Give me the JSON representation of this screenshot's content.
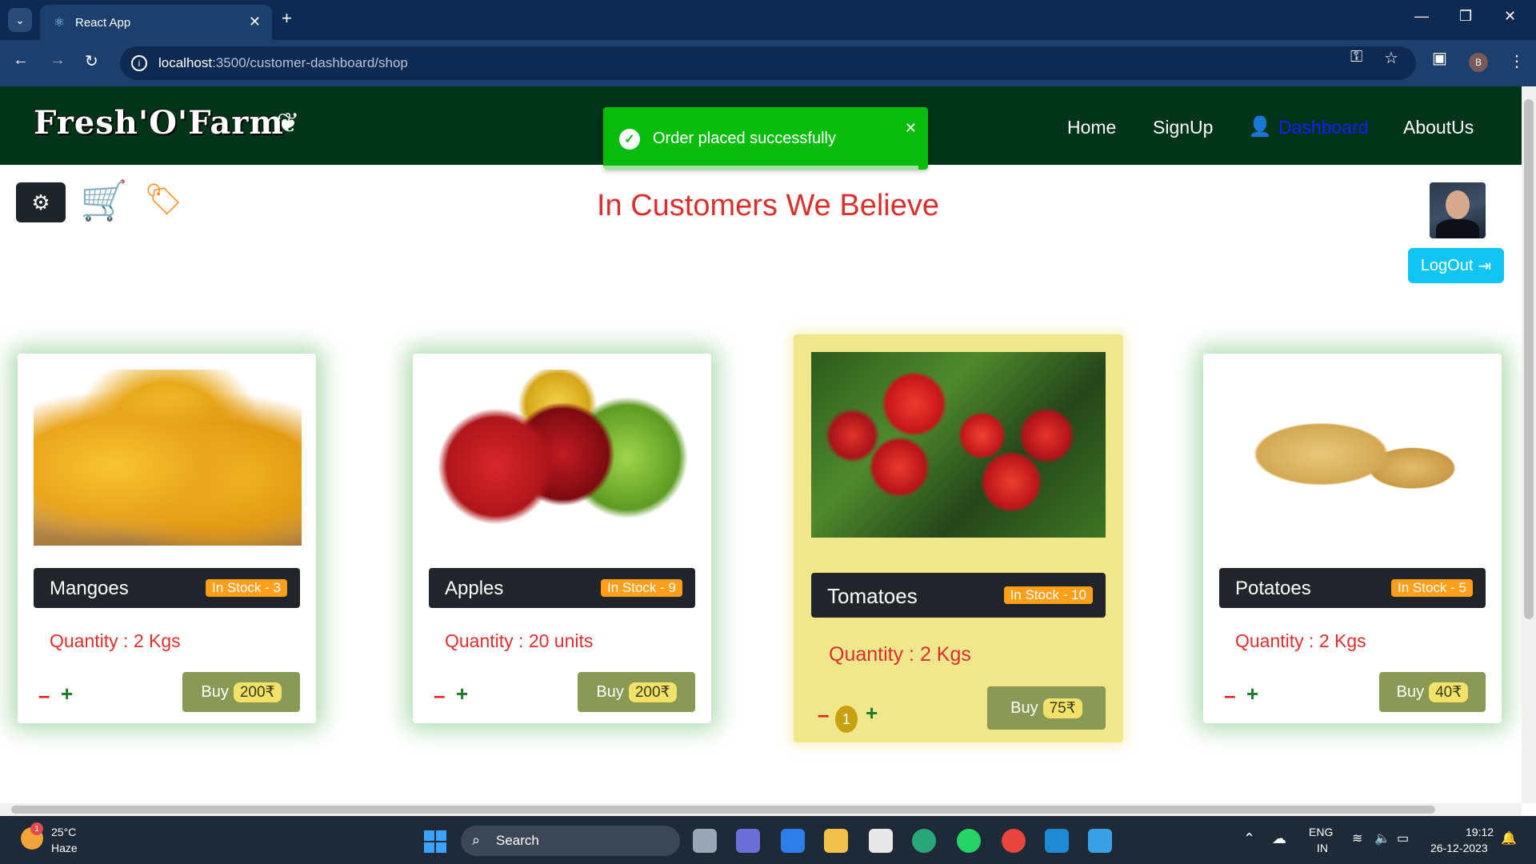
{
  "browser": {
    "tab_title": "React App",
    "url_host": "localhost",
    "url_path": ":3500/customer-dashboard/shop",
    "profile_initial": "B"
  },
  "navbar": {
    "logo": "Fresh'O'Farm",
    "links": [
      "Home",
      "SignUp",
      "Dashboard",
      "AboutUs"
    ]
  },
  "toast": {
    "message": "Order placed successfully"
  },
  "header": {
    "headline": "In Customers We Believe",
    "logout_label": "LogOut"
  },
  "products": [
    {
      "name": "Mangoes",
      "stock": "In Stock - 3",
      "quantity": "Quantity : 2 Kgs",
      "buy_label": "Buy",
      "price": "200₹"
    },
    {
      "name": "Apples",
      "stock": "In Stock - 9",
      "quantity": "Quantity : 20 units",
      "buy_label": "Buy",
      "price": "200₹"
    },
    {
      "name": "Tomatoes",
      "stock": "In Stock - 10",
      "quantity": "Quantity : 2 Kgs",
      "buy_label": "Buy",
      "price": "75₹",
      "count": "1"
    },
    {
      "name": "Potatoes",
      "stock": "In Stock - 5",
      "quantity": "Quantity : 2 Kgs",
      "buy_label": "Buy",
      "price": "40₹"
    }
  ],
  "controls": {
    "minus": "–",
    "plus": "+"
  },
  "taskbar": {
    "weather_badge": "1",
    "temperature": "25°C",
    "condition": "Haze",
    "search_label": "Search",
    "language": "ENG",
    "region": "IN",
    "time": "19:12",
    "date": "26-12-2023"
  }
}
